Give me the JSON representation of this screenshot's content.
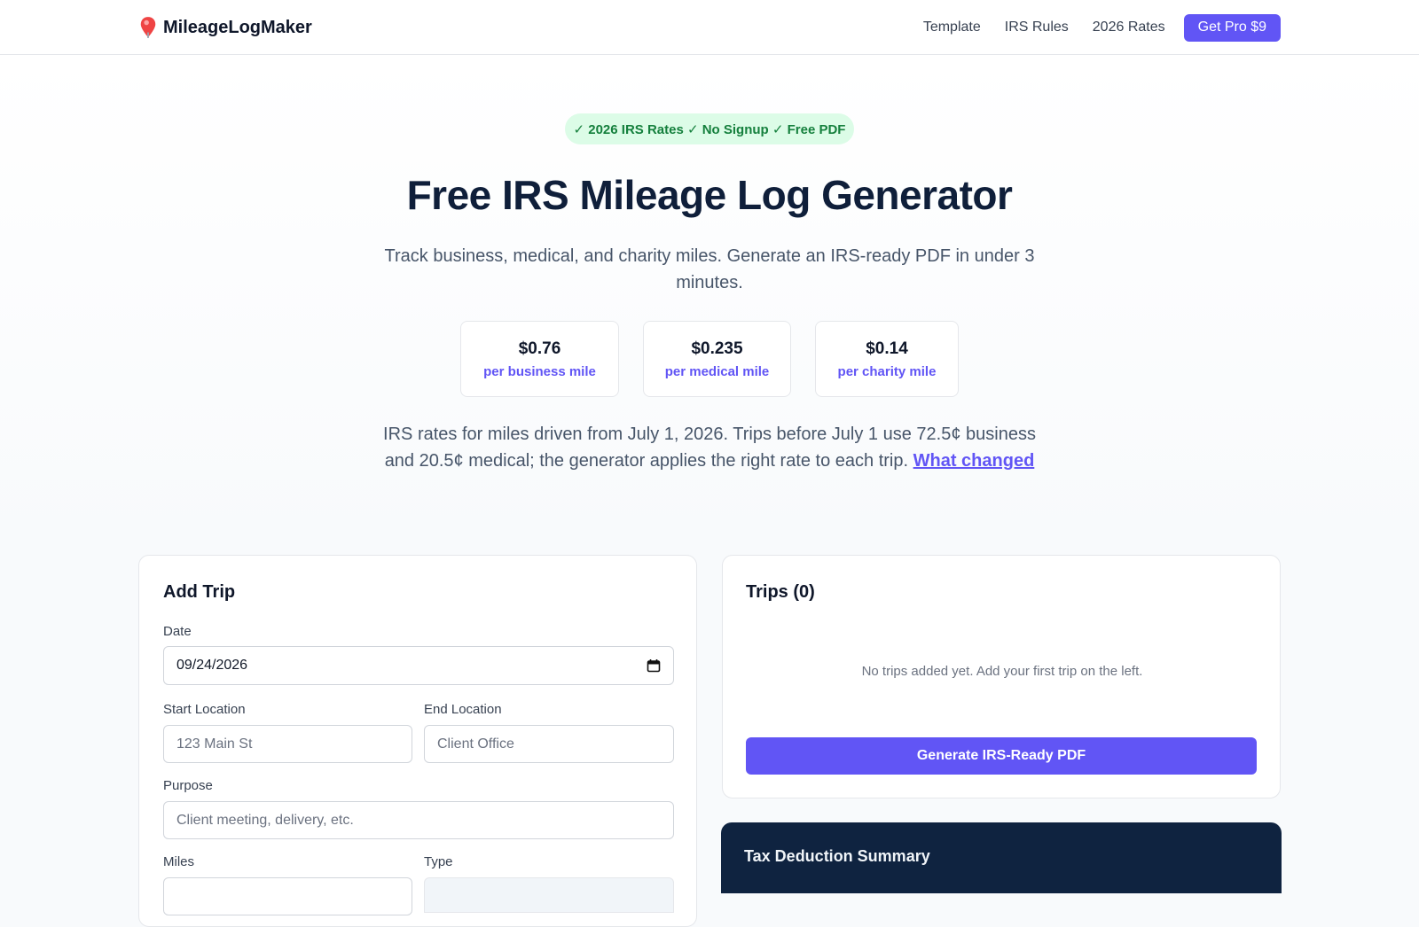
{
  "header": {
    "brand_icon": "map-pin-icon",
    "brand_name": "MileageLogMaker",
    "nav": [
      {
        "label": "Template"
      },
      {
        "label": "IRS Rules"
      },
      {
        "label": "2026 Rates"
      }
    ],
    "pro_label": "Get Pro $9",
    "accent": "#6155f5"
  },
  "hero": {
    "badge": "✓ 2026 IRS Rates ✓ No Signup ✓ Free PDF",
    "title": "Free IRS Mileage Log Generator",
    "subtitle": "Track business, medical, and charity miles. Generate an IRS-ready PDF in under 3 minutes.",
    "rates": [
      {
        "value": "$0.76",
        "label": "per business mile"
      },
      {
        "value": "$0.235",
        "label": "per medical mile"
      },
      {
        "value": "$0.14",
        "label": "per charity mile"
      }
    ],
    "note": "IRS rates for miles driven from July 1, 2026. Trips before July 1 use 72.5¢ business and 20.5¢ medical; the generator applies the right rate to each trip.",
    "note_link": "What changed"
  },
  "add_trip": {
    "title": "Add Trip",
    "date_label": "Date",
    "date_value": "09/24/2026",
    "start_label": "Start Location",
    "start_placeholder": "123 Main St",
    "end_label": "End Location",
    "end_placeholder": "Client Office",
    "purpose_label": "Purpose",
    "purpose_placeholder": "Client meeting, delivery, etc.",
    "miles_label": "Miles",
    "type_label": "Type"
  },
  "trips": {
    "title": "Trips (0)",
    "empty": "No trips added yet. Add your first trip on the left.",
    "generate_label": "Generate IRS-Ready PDF"
  },
  "summary": {
    "title": "Tax Deduction Summary"
  }
}
